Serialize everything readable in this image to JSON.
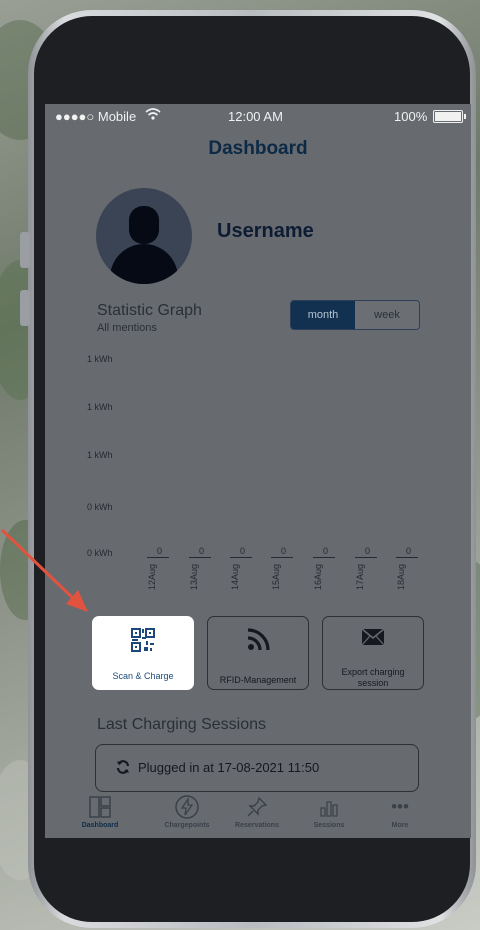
{
  "status_bar": {
    "carrier": "●●●●○ Mobile",
    "time": "12:00 AM",
    "battery": "100%"
  },
  "header": {
    "title": "Dashboard"
  },
  "profile": {
    "username": "Username"
  },
  "statistics": {
    "title": "Statistic Graph",
    "subtitle": "All mentions",
    "toggle": {
      "month": "month",
      "week": "week",
      "selected": "month"
    }
  },
  "chart_data": {
    "type": "bar",
    "y_tick_labels": [
      "1 kWh",
      "1 kWh",
      "1 kWh",
      "0 kWh",
      "0 kWh"
    ],
    "categories": [
      "12Aug",
      "13Aug",
      "14Aug",
      "15Aug",
      "16Aug",
      "17Aug",
      "18Aug"
    ],
    "values": [
      0,
      0,
      0,
      0,
      0,
      0,
      0
    ]
  },
  "actions": [
    {
      "label": "Scan & Charge",
      "icon": "qr-code-icon",
      "highlighted": true
    },
    {
      "label": "RFID-Management",
      "icon": "rfid-icon",
      "highlighted": false
    },
    {
      "label": "Export charging session",
      "icon": "envelope-icon",
      "highlighted": false
    }
  ],
  "sessions": {
    "title": "Last Charging Sessions",
    "items": [
      {
        "text": "Plugged in at  17-08-2021 11:50",
        "icon": "refresh-icon"
      }
    ]
  },
  "tabs": [
    {
      "label": "Dashboard",
      "icon": "dashboard-icon",
      "active": true
    },
    {
      "label": "Chargepoints",
      "icon": "bolt-icon",
      "active": false
    },
    {
      "label": "Reservations",
      "icon": "pin-icon",
      "active": false
    },
    {
      "label": "Sessions",
      "icon": "bar-chart-icon",
      "active": false
    },
    {
      "label": "More",
      "icon": "more-icon",
      "active": false
    }
  ],
  "colors": {
    "accent": "#12304f",
    "annotation_arrow": "#e2533f",
    "screen_overlay": "#676b70"
  }
}
